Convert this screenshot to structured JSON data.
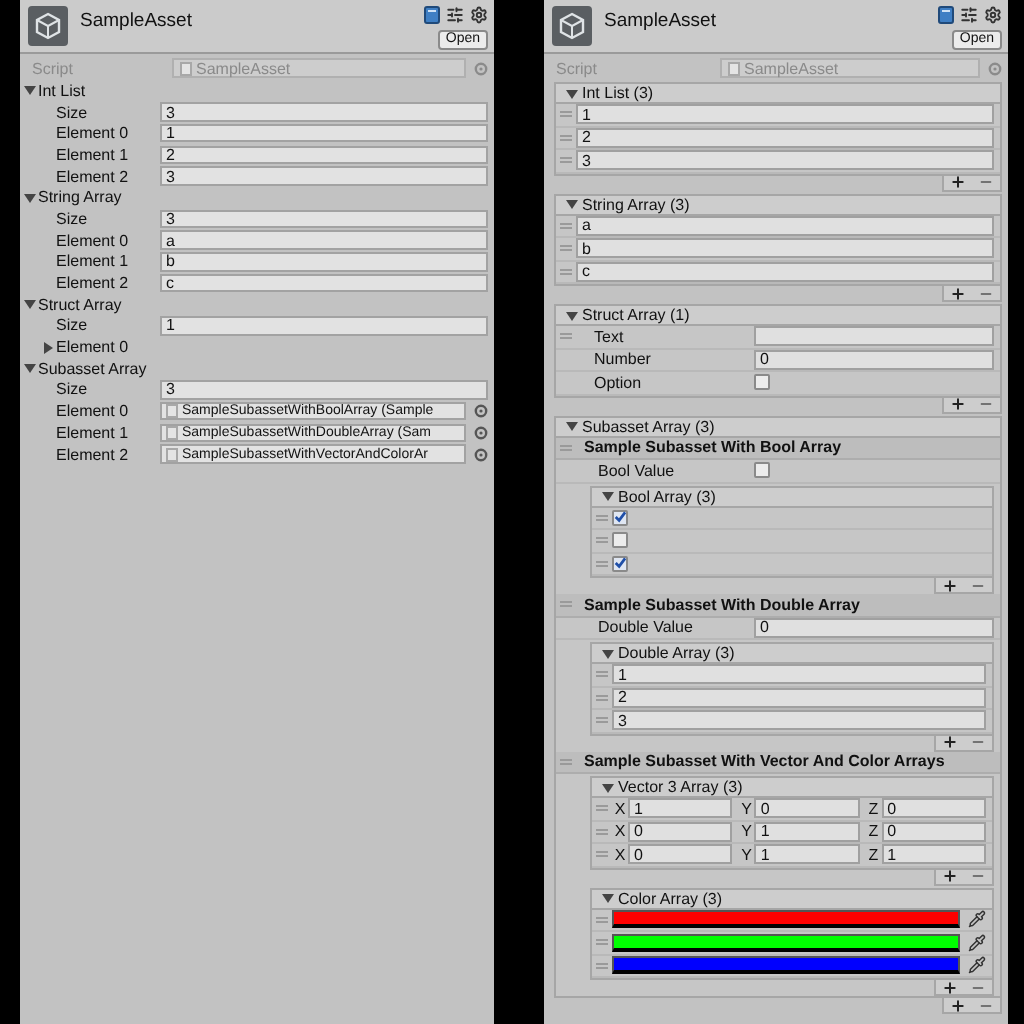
{
  "left_inspector": {
    "title": "SampleAsset",
    "open_button": "Open",
    "script": {
      "label": "Script",
      "value": "SampleAsset"
    },
    "properties": [
      {
        "kind": "group",
        "label": "Int List",
        "expanded": true,
        "children": [
          {
            "kind": "field",
            "label": "Size",
            "value": "3"
          },
          {
            "kind": "field",
            "label": "Element 0",
            "value": "1"
          },
          {
            "kind": "field",
            "label": "Element 1",
            "value": "2"
          },
          {
            "kind": "field",
            "label": "Element 2",
            "value": "3"
          }
        ]
      },
      {
        "kind": "group",
        "label": "String Array",
        "expanded": true,
        "children": [
          {
            "kind": "field",
            "label": "Size",
            "value": "3"
          },
          {
            "kind": "field",
            "label": "Element 0",
            "value": "a"
          },
          {
            "kind": "field",
            "label": "Element 1",
            "value": "b"
          },
          {
            "kind": "field",
            "label": "Element 2",
            "value": "c"
          }
        ]
      },
      {
        "kind": "group",
        "label": "Struct Array",
        "expanded": true,
        "children": [
          {
            "kind": "field",
            "label": "Size",
            "value": "1"
          },
          {
            "kind": "group",
            "label": "Element 0",
            "expanded": false
          }
        ]
      },
      {
        "kind": "group",
        "label": "Subasset Array",
        "expanded": true,
        "children": [
          {
            "kind": "field",
            "label": "Size",
            "value": "3"
          },
          {
            "kind": "object",
            "label": "Element 0",
            "value": "SampleSubassetWithBoolArray (Sample"
          },
          {
            "kind": "object",
            "label": "Element 1",
            "value": "SampleSubassetWithDoubleArray (Sam"
          },
          {
            "kind": "object",
            "label": "Element 2",
            "value": "SampleSubassetWithVectorAndColorAr"
          }
        ]
      }
    ]
  },
  "right_inspector": {
    "title": "SampleAsset",
    "open_button": "Open",
    "script": {
      "label": "Script",
      "value": "SampleAsset"
    },
    "lists": [
      {
        "title": "Int List (3)",
        "expanded": true,
        "items": [
          {
            "kind": "text",
            "value": "1"
          },
          {
            "kind": "text",
            "value": "2"
          },
          {
            "kind": "text",
            "value": "3"
          }
        ]
      },
      {
        "title": "String Array (3)",
        "expanded": true,
        "items": [
          {
            "kind": "text",
            "value": "a"
          },
          {
            "kind": "text",
            "value": "b"
          },
          {
            "kind": "text",
            "value": "c"
          }
        ]
      },
      {
        "title": "Struct Array (1)",
        "expanded": true,
        "items": [
          {
            "kind": "struct",
            "fields": [
              {
                "kind": "text",
                "label": "Text"
              },
              {
                "kind": "text",
                "label": "Number",
                "value": "0"
              },
              {
                "kind": "checkbox",
                "label": "Option",
                "checked": false
              }
            ]
          }
        ]
      },
      {
        "title": "Subasset Array (3)",
        "expanded": true,
        "items": [
          {
            "kind": "subasset",
            "title": "Sample Subasset With Bool Array",
            "fields": [
              {
                "kind": "checkbox",
                "label": "Bool Value",
                "checked": false
              },
              {
                "kind": "list",
                "title": "Bool Array (3)",
                "expanded": true,
                "items": [
                  {
                    "kind": "checkbox",
                    "checked": true
                  },
                  {
                    "kind": "checkbox",
                    "checked": false
                  },
                  {
                    "kind": "checkbox",
                    "checked": true
                  }
                ]
              }
            ]
          },
          {
            "kind": "subasset",
            "title": "Sample Subasset With Double Array",
            "fields": [
              {
                "kind": "text",
                "label": "Double Value",
                "value": "0"
              },
              {
                "kind": "list",
                "title": "Double Array (3)",
                "expanded": true,
                "items": [
                  {
                    "kind": "text",
                    "value": "1"
                  },
                  {
                    "kind": "text",
                    "value": "2"
                  },
                  {
                    "kind": "text",
                    "value": "3"
                  }
                ]
              }
            ]
          },
          {
            "kind": "subasset",
            "title": "Sample Subasset With Vector And Color Arrays",
            "fields": [
              {
                "kind": "list",
                "title": "Vector 3 Array (3)",
                "expanded": true,
                "items": [
                  {
                    "kind": "vector",
                    "components": [
                      {
                        "label": "X",
                        "value": "1"
                      },
                      {
                        "label": "Y",
                        "value": "0"
                      },
                      {
                        "label": "Z",
                        "value": "0"
                      }
                    ]
                  },
                  {
                    "kind": "vector",
                    "components": [
                      {
                        "label": "X",
                        "value": "0"
                      },
                      {
                        "label": "Y",
                        "value": "1"
                      },
                      {
                        "label": "Z",
                        "value": "0"
                      }
                    ]
                  },
                  {
                    "kind": "vector",
                    "components": [
                      {
                        "label": "X",
                        "value": "0"
                      },
                      {
                        "label": "Y",
                        "value": "1"
                      },
                      {
                        "label": "Z",
                        "value": "1"
                      }
                    ]
                  }
                ]
              },
              {
                "kind": "list",
                "title": "Color Array (3)",
                "expanded": true,
                "items": [
                  {
                    "kind": "color",
                    "color": "#ff0000"
                  },
                  {
                    "kind": "color",
                    "color": "#00ff00"
                  },
                  {
                    "kind": "color",
                    "color": "#0000ff"
                  }
                ]
              }
            ]
          }
        ]
      }
    ]
  }
}
